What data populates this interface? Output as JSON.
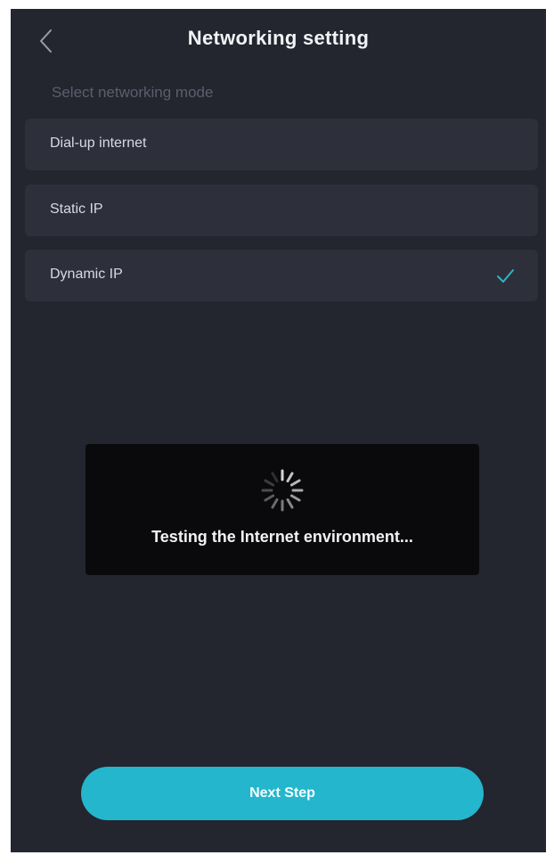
{
  "header": {
    "title": "Networking setting",
    "back_icon": "chevron-left-icon"
  },
  "mode_section": {
    "label": "Select networking mode",
    "options": [
      {
        "label": "Dial-up internet",
        "selected": false
      },
      {
        "label": "Static IP",
        "selected": false
      },
      {
        "label": "Dynamic IP",
        "selected": true
      }
    ],
    "check_icon": "checkmark-icon"
  },
  "loading_toast": {
    "icon": "spinner-icon",
    "message": "Testing the Internet environment..."
  },
  "footer": {
    "next_label": "Next Step"
  },
  "colors": {
    "background": "#23252f",
    "option_background": "#2d303b",
    "accent": "#24b6cc",
    "check": "#2fb4c8",
    "toast_background": "#0a0a0c"
  }
}
